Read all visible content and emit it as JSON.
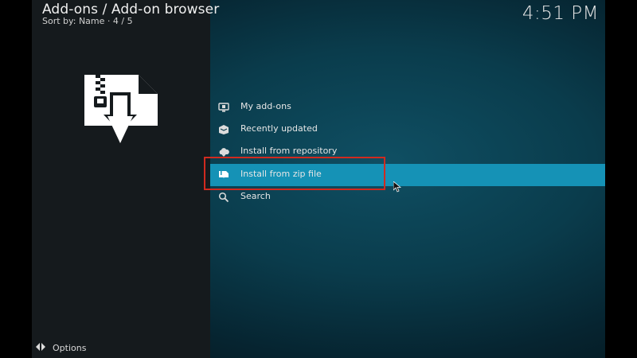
{
  "header": {
    "title": "Add-ons / Add-on browser",
    "subtitle": "Sort by: Name  ·  4 / 5",
    "clock": "4:51 PM"
  },
  "hero": {
    "icon": "zip-install-icon"
  },
  "menu": {
    "items": [
      {
        "label": "My add-ons",
        "icon": "monitor-icon"
      },
      {
        "label": "Recently updated",
        "icon": "box-icon"
      },
      {
        "label": "Install from repository",
        "icon": "cloud-icon"
      },
      {
        "label": "Install from zip file",
        "icon": "zip-icon",
        "focused": true
      },
      {
        "label": "Search",
        "icon": "search-icon"
      }
    ]
  },
  "footer": {
    "options_label": "Options"
  },
  "colors": {
    "focus": "#1592b6",
    "highlight_border": "#d12a1f",
    "panel": "#151a1d"
  }
}
